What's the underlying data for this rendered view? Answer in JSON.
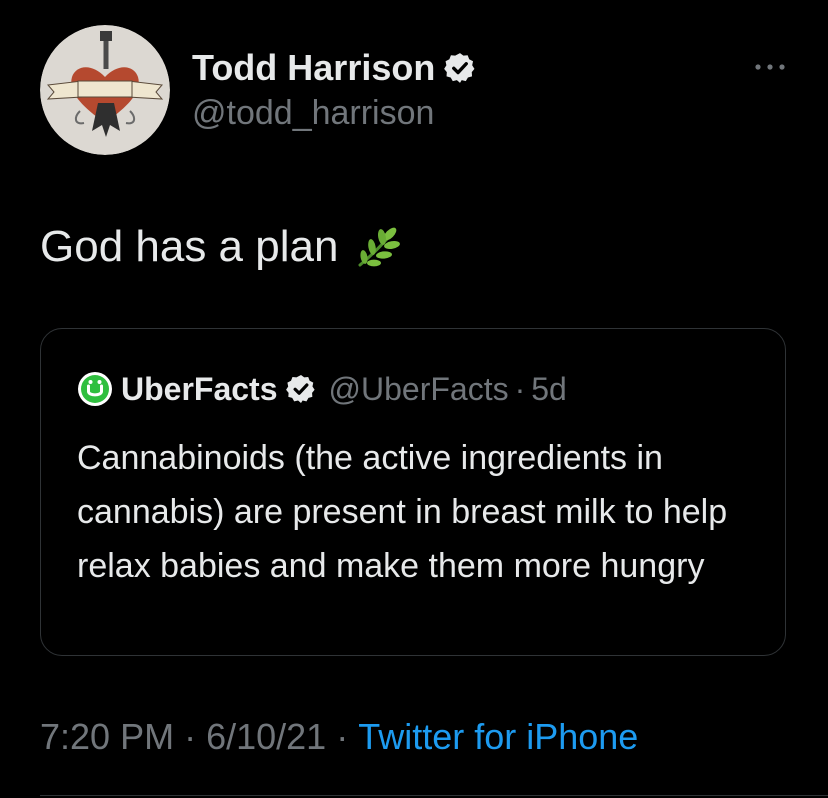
{
  "colors": {
    "background": "#000000",
    "text_primary": "#e7e9ea",
    "text_secondary": "#71767b",
    "link": "#1d9bf0",
    "border": "#2f3336",
    "uberfacts_green": "#2fbf3f"
  },
  "tweet": {
    "author": {
      "display_name": "Todd Harrison",
      "handle": "@todd_harrison",
      "verified": true,
      "avatar_icon": "tom-petty-heart-guitar-avatar"
    },
    "text": "God has a plan",
    "emoji_icon": "herb-icon",
    "more_icon": "more-dots-icon",
    "quoted": {
      "display_name": "UberFacts",
      "handle": "@UberFacts",
      "separator": "·",
      "time": "5d",
      "verified": true,
      "avatar_icon": "uberfacts-logo-icon",
      "text": "Cannabinoids (the active ingredients in cannabis) are present in breast milk to help relax babies and make them more hungry"
    },
    "meta": {
      "time": "7:20 PM",
      "sep1": "·",
      "date": "6/10/21",
      "sep2": "·",
      "source": "Twitter for iPhone"
    }
  }
}
